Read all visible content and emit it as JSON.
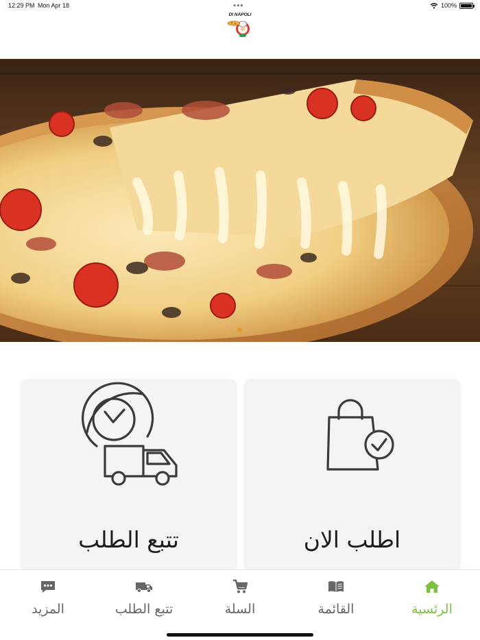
{
  "status": {
    "time": "12:29 PM",
    "date": "Mon Apr 18",
    "battery": "100%",
    "battery_level": 1.0
  },
  "logo": {
    "text": "DI NAPOLI",
    "icon": "chef-logo"
  },
  "hero": {
    "icon": "pizza-photo",
    "carousel_dot_color": "#e79a2b"
  },
  "cards": {
    "track": {
      "label": "تتبع الطلب",
      "icon": "clock-truck-icon"
    },
    "order": {
      "label": "اطلب الان",
      "icon": "shopping-bag-check-icon"
    }
  },
  "tabbar": {
    "active_color": "#7cc242",
    "items": [
      {
        "label": "الرئسية",
        "icon": "home-icon",
        "active": true
      },
      {
        "label": "القائمة",
        "icon": "book-icon",
        "active": false
      },
      {
        "label": "السلة",
        "icon": "cart-icon",
        "active": false
      },
      {
        "label": "تتبع الطلب",
        "icon": "truck-icon",
        "active": false
      },
      {
        "label": "المزيد",
        "icon": "more-icon",
        "active": false
      }
    ]
  }
}
